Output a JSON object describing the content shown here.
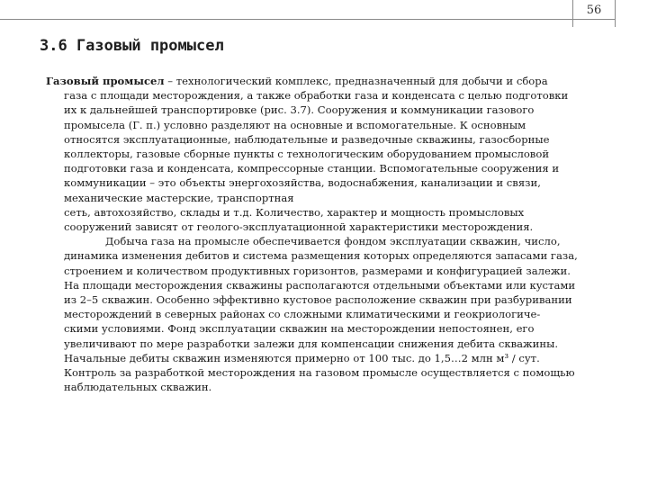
{
  "page": {
    "number": "56"
  },
  "title": "3.6 Газовый промысел",
  "lead_term": "Газовый промысел",
  "lines": [
    " – технологический комплекс, предназначенный для добычи и сбора",
    "газа с площади месторождения, а также обработки газа и конденсата с целью подготовки",
    "их к дальнейшей транспортировке (рис. 3.7). Сооружения и коммуникации газового",
    "промысела (Г. п.) условно разделяют на основные и вспомогательные. К основным",
    "относятся эксплуатационные, наблюдательные и разведочные скважины, газосборные",
    "коллекторы, газовые сборные пункты с технологическим оборудованием промысловой",
    "подготовки газа и конденсата, компрессорные станции. Вспомогательные сооружения и",
    "коммуникации – это объекты энергохозяйства, водоснабжения, канализации и связи,",
    "механические мастерские, транспортная",
    "сеть, автохозяйство, склады и т.д. Количество, характер и мощность промысловых",
    "сооружений зависят от геолого-эксплуатационной характеристики месторождения.",
    "Добыча газа на промысле обеспечивается фондом эксплуатации скважин, число,",
    "динамика изменения дебитов и система размещения которых определяются запасами газа,",
    "строением и количеством продуктивных горизонтов, размерами и конфигурацией залежи.",
    "На площади месторождения скважины располагаются отдельными объектами или кустами",
    "из 2–5 скважин. Особенно эффективно кустовое расположение скважин при разбуривании",
    "месторождений в северных районах со сложными климатическими и геокриологиче-",
    "скими условиями. Фонд эксплуатации скважин на месторождении непостоянен, его",
    "увеличивают по мере разработки залежи для компенсации снижения дебита скважины.",
    "Начальные дебиты скважин изменяются примерно от 100 тыс. до 1,5…2 млн м³ / сут.",
    "Контроль за разработкой месторождения на газовом промысле осуществляется с помощью",
    "наблюдательных скважин."
  ]
}
